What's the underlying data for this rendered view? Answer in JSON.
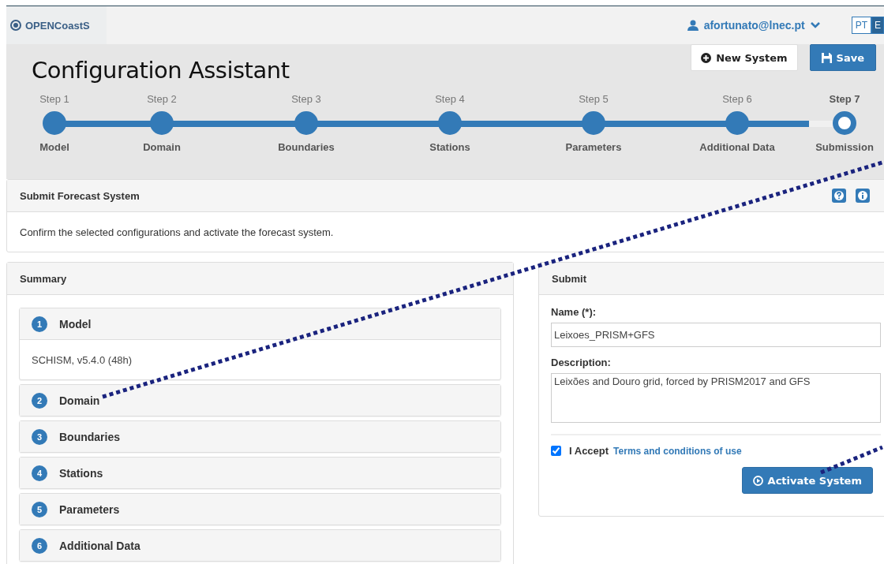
{
  "header": {
    "brand": "OPENCoastS",
    "user": "afortunato@lnec.pt",
    "languages": [
      {
        "label": "PT",
        "selected": false
      },
      {
        "label": "E",
        "selected": true
      }
    ]
  },
  "toolbar": {
    "title": "Configuration Assistant",
    "buttons": [
      {
        "label": "New System",
        "kind": "plain"
      },
      {
        "label": "Save",
        "kind": "primary"
      }
    ]
  },
  "steps": [
    {
      "step": "Step 1",
      "name": "Model",
      "completed": true,
      "selected": false
    },
    {
      "step": "Step 2",
      "name": "Domain",
      "completed": true,
      "selected": false
    },
    {
      "step": "Step 3",
      "name": "Boundaries",
      "completed": true,
      "selected": false
    },
    {
      "step": "Step 4",
      "name": "Stations",
      "completed": true,
      "selected": false
    },
    {
      "step": "Step 5",
      "name": "Parameters",
      "completed": true,
      "selected": false
    },
    {
      "step": "Step 6",
      "name": "Additional Data",
      "completed": true,
      "selected": false
    },
    {
      "step": "Step 7",
      "name": "Submission",
      "completed": false,
      "selected": true
    }
  ],
  "intro": {
    "title": "Submit Forecast System",
    "text": "Confirm the selected configurations and activate the forecast system."
  },
  "summary": {
    "title": "Summary",
    "items": [
      {
        "number": "1",
        "title": "Model",
        "expanded": true,
        "content": "SCHISM, v5.4.0 (48h)"
      },
      {
        "number": "2",
        "title": "Domain",
        "expanded": false
      },
      {
        "number": "3",
        "title": "Boundaries",
        "expanded": false
      },
      {
        "number": "4",
        "title": "Stations",
        "expanded": false
      },
      {
        "number": "5",
        "title": "Parameters",
        "expanded": false
      },
      {
        "number": "6",
        "title": "Additional Data",
        "expanded": false
      }
    ]
  },
  "submit": {
    "title": "Submit",
    "name_label": "Name (*):",
    "name_value": "Leixoes_PRISM+GFS",
    "description_label": "Description:",
    "description_value": "Leixões and Douro grid, forced by PRISM2017 and GFS",
    "accept": {
      "checked": true,
      "label": "I Accept",
      "link": "Terms and conditions of use"
    },
    "button": "Activate System"
  }
}
